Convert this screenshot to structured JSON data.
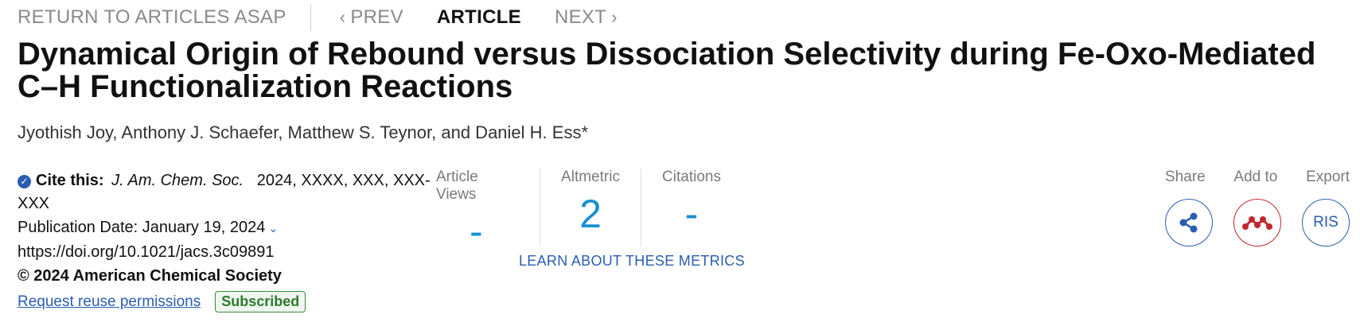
{
  "topnav": {
    "return_label": "RETURN TO ARTICLES ASAP",
    "prev_label": "PREV",
    "article_label": "ARTICLE",
    "next_label": "NEXT"
  },
  "article": {
    "title": "Dynamical Origin of Rebound versus Dissociation Selectivity during Fe-Oxo-Mediated C–H Functionalization Reactions",
    "authors": "Jyothish Joy, Anthony J. Schaefer, Matthew S. Teynor, and Daniel H. Ess*"
  },
  "citation": {
    "cite_label": "Cite this:",
    "journal": "J. Am. Chem. Soc.",
    "citation_rest": "2024, XXXX, XXX, XXX-XXX",
    "publication_date": "Publication Date: January 19, 2024",
    "doi": "https://doi.org/10.1021/jacs.3c09891",
    "copyright": "© 2024 American Chemical Society",
    "reuse_link": "Request reuse permissions",
    "access_badge": "Subscribed"
  },
  "metrics": {
    "views_label": "Article Views",
    "views_value": "-",
    "altmetric_label": "Altmetric",
    "altmetric_value": "2",
    "citations_label": "Citations",
    "citations_value": "-",
    "learn_link": "LEARN ABOUT THESE METRICS"
  },
  "actions": {
    "share_label": "Share",
    "add_to_label": "Add to",
    "export_label": "Export",
    "ris_label": "RIS"
  },
  "colors": {
    "link_blue": "#2a5db0",
    "metric_blue": "#1a8fd1",
    "mendeley_red": "#c2272d",
    "subscribed_green": "#2d7a2d"
  }
}
